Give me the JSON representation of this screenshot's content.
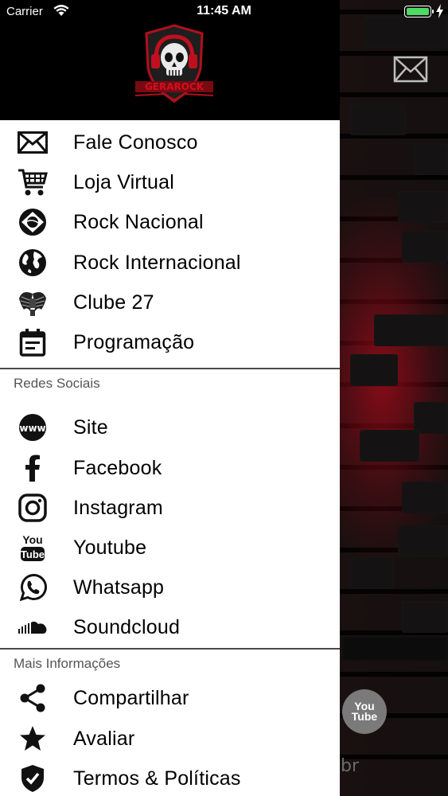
{
  "status_bar": {
    "carrier": "Carrier",
    "time": "11:45 AM",
    "battery_color": "#4cd964"
  },
  "drawer": {
    "logo_icon": "skull-logo-icon",
    "logo_text": "GERAROCK",
    "main_items": [
      {
        "label": "Fale Conosco",
        "icon": "mail-icon"
      },
      {
        "label": "Loja Virtual",
        "icon": "shopping-cart-icon"
      },
      {
        "label": "Rock Nacional",
        "icon": "brazil-flag-icon"
      },
      {
        "label": "Rock Internacional",
        "icon": "globe-icon"
      },
      {
        "label": "Clube 27",
        "icon": "winged-emblem-icon"
      },
      {
        "label": "Programação",
        "icon": "calendar-icon"
      }
    ],
    "social_section_title": "Redes Sociais",
    "social_items": [
      {
        "label": "Site",
        "icon": "www-icon"
      },
      {
        "label": "Facebook",
        "icon": "facebook-icon"
      },
      {
        "label": "Instagram",
        "icon": "instagram-icon"
      },
      {
        "label": "Youtube",
        "icon": "youtube-icon"
      },
      {
        "label": "Whatsapp",
        "icon": "whatsapp-icon"
      },
      {
        "label": "Soundcloud",
        "icon": "soundcloud-icon"
      }
    ],
    "info_section_title": "Mais Informações",
    "info_items": [
      {
        "label": "Compartilhar",
        "icon": "share-icon"
      },
      {
        "label": "Avaliar",
        "icon": "star-icon"
      },
      {
        "label": "Termos & Políticas",
        "icon": "shield-check-icon"
      }
    ]
  },
  "background": {
    "youtube_button_text": "You Tube",
    "partial_text": "br",
    "accent_color": "#b0101e"
  }
}
